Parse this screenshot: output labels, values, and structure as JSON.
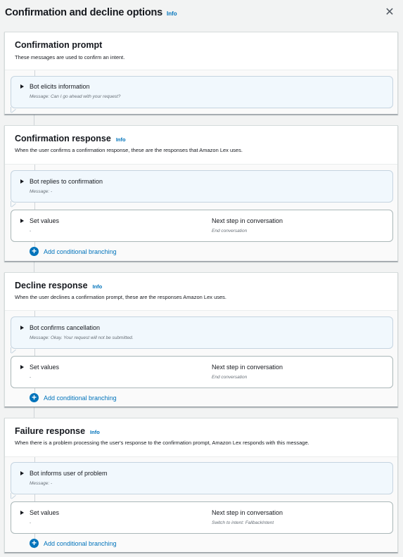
{
  "header": {
    "title": "Confirmation and decline options",
    "info": "Info",
    "close": "✕"
  },
  "confirmation_prompt": {
    "title": "Confirmation prompt",
    "desc": "These messages are used to confirm an intent.",
    "card": {
      "title": "Bot elicits information",
      "message": "Message: Can I go ahead with your request?"
    }
  },
  "confirmation_response": {
    "title": "Confirmation response",
    "info": "Info",
    "desc": "When the user confirms a confirmation response, these are the responses that Amazon Lex uses.",
    "reply_card": {
      "title": "Bot replies to confirmation",
      "message": "Message: -"
    },
    "values_card": {
      "title": "Set values",
      "value": "-",
      "next_title": "Next step in conversation",
      "next_value": "End conversation"
    },
    "branch": "Add conditional branching"
  },
  "decline_response": {
    "title": "Decline response",
    "info": "Info",
    "desc": "When the user declines a confirmation prompt, these are the responses Amazon Lex uses.",
    "reply_card": {
      "title": "Bot confirms cancellation",
      "message": "Message: Okay. Your request will not be submitted."
    },
    "values_card": {
      "title": "Set values",
      "value": "-",
      "next_title": "Next step in conversation",
      "next_value": "End conversation"
    },
    "branch": "Add conditional branching"
  },
  "failure_response": {
    "title": "Failure response",
    "info": "Info",
    "desc": "When there is a problem processing the user's response to the confirmation prompt, Amazon Lex responds with this message.",
    "reply_card": {
      "title": "Bot informs user of problem",
      "message": "Message: -"
    },
    "values_card": {
      "title": "Set values",
      "value": "-",
      "next_title": "Next step in conversation",
      "next_value": "Switch to intent: FallbackIntent"
    },
    "branch": "Add conditional branching"
  },
  "colors": {
    "link": "#0073bb",
    "bubble": "#f1f8fd",
    "background": "#f2f3f3"
  }
}
